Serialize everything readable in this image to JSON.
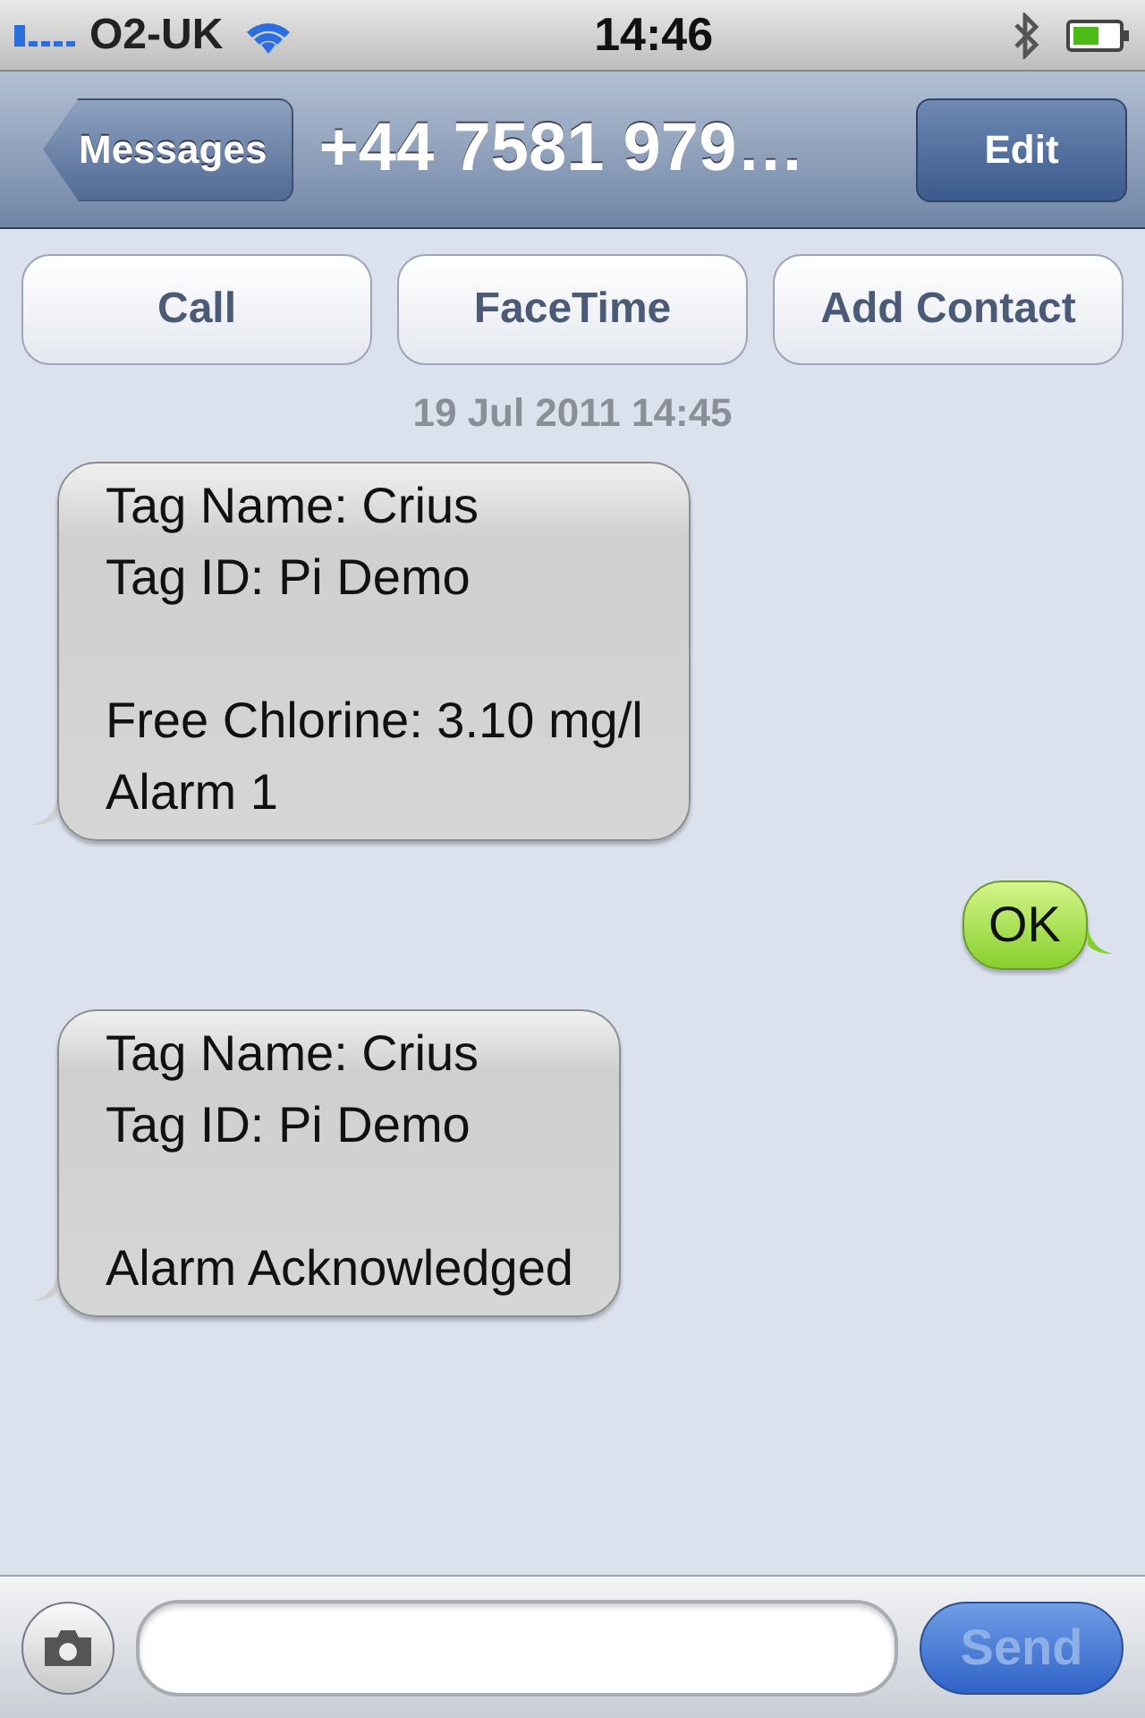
{
  "status_bar": {
    "carrier": "O2-UK",
    "time": "14:46"
  },
  "nav_bar": {
    "back": "Messages",
    "title": "+44 7581 979…",
    "edit": "Edit"
  },
  "actions": [
    "Call",
    "FaceTime",
    "Add Contact"
  ],
  "timestamp": "19 Jul 2011 14:45",
  "messages": [
    {
      "kind": "incoming",
      "text": "Tag Name: Crius\nTag ID: Pi Demo\n\nFree Chlorine: 3.10 mg/l\nAlarm 1"
    },
    {
      "kind": "outgoing",
      "text": "OK"
    },
    {
      "kind": "incoming",
      "text": "Tag Name: Crius\nTag ID: Pi Demo\n\nAlarm Acknowledged"
    }
  ],
  "composer": {
    "send": "Send",
    "send_disabled": true
  }
}
